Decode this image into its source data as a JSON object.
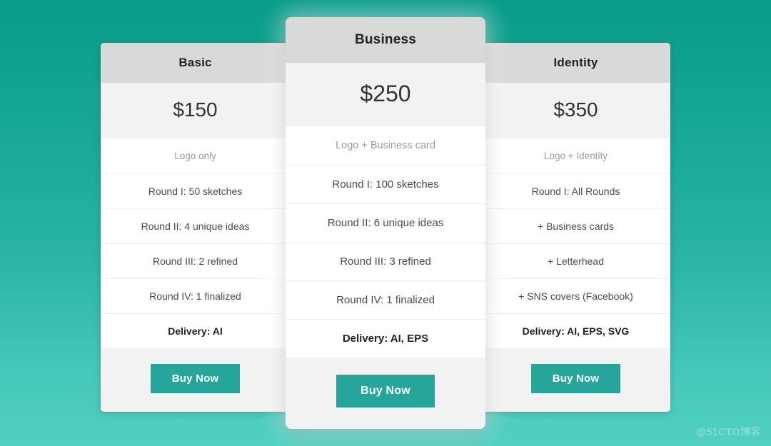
{
  "page": {
    "background_top_color": "#089c89",
    "background_bottom_color": "#52d0c1",
    "accent_color": "#26a69a",
    "header_color": "#d9d9d9",
    "panel_color": "#f2f2f2",
    "watermark": "@51CTO博客"
  },
  "plans": [
    {
      "name": "Basic",
      "price": "$150",
      "subtitle": "Logo only",
      "features": [
        {
          "text": "Round I: 50 sketches",
          "bold": false
        },
        {
          "text": "Round II: 4 unique ideas",
          "bold": false
        },
        {
          "text": "Round III: 2 refined",
          "bold": false
        },
        {
          "text": "Round IV: 1 finalized",
          "bold": false
        },
        {
          "text": "Delivery: AI",
          "bold": true
        }
      ],
      "cta": "Buy Now",
      "featured": false
    },
    {
      "name": "Business",
      "price": "$250",
      "subtitle": "Logo + Business card",
      "features": [
        {
          "text": "Round I: 100 sketches",
          "bold": false
        },
        {
          "text": "Round II: 6 unique ideas",
          "bold": false
        },
        {
          "text": "Round III: 3 refined",
          "bold": false
        },
        {
          "text": "Round IV: 1 finalized",
          "bold": false
        },
        {
          "text": "Delivery: AI, EPS",
          "bold": true
        }
      ],
      "cta": "Buy Now",
      "featured": true
    },
    {
      "name": "Identity",
      "price": "$350",
      "subtitle": "Logo + Identity",
      "features": [
        {
          "text": "Round I: All Rounds",
          "bold": false
        },
        {
          "text": "+ Business cards",
          "bold": false
        },
        {
          "text": "+ Letterhead",
          "bold": false
        },
        {
          "text": "+ SNS covers (Facebook)",
          "bold": false
        },
        {
          "text": "Delivery: AI, EPS, SVG",
          "bold": true
        }
      ],
      "cta": "Buy Now",
      "featured": false
    }
  ]
}
